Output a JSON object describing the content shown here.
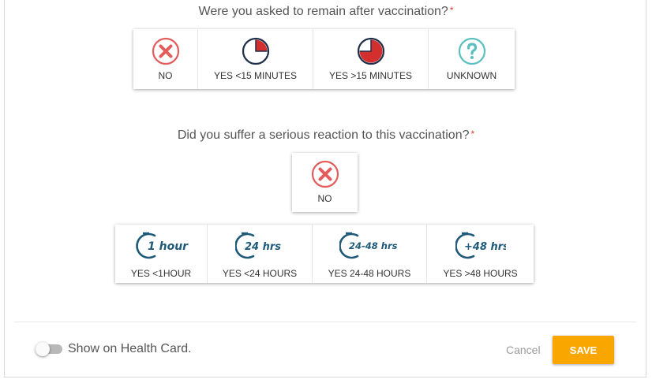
{
  "colors": {
    "accent": "#f9a600",
    "required": "#e53935",
    "no_red": "#e35b5b",
    "unknown_teal": "#5bbfbf",
    "timer_blue": "#1f5a7a",
    "pie_red": "#d32f2f"
  },
  "q1": {
    "question": "Were you asked to remain after vaccination?",
    "required_mark": "*",
    "options": [
      {
        "label": "NO",
        "icon": "x-circle-icon"
      },
      {
        "label": "YES <15 MINUTES",
        "icon": "clock-quarter-icon"
      },
      {
        "label": "YES >15 MINUTES",
        "icon": "clock-three-quarter-icon"
      },
      {
        "label": "UNKNOWN",
        "icon": "question-circle-icon"
      }
    ]
  },
  "q2": {
    "question": "Did you suffer a serious reaction to this vaccination?",
    "required_mark": "*",
    "no_option": {
      "label": "NO",
      "icon": "x-circle-icon"
    },
    "timer_options": [
      {
        "label": "YES <1HOUR",
        "icon_text": "1 hour",
        "icon": "timer-1-hour-icon"
      },
      {
        "label": "YES <24 HOURS",
        "icon_text": "24 hrs",
        "icon": "timer-24-hrs-icon"
      },
      {
        "label": "YES 24-48 HOURS",
        "icon_text": "24-48 hrs",
        "icon": "timer-24-48-hrs-icon"
      },
      {
        "label": "YES >48 HOURS",
        "icon_text": "+48 hrs",
        "icon": "timer-48-hrs-icon"
      }
    ]
  },
  "footer": {
    "toggle_label": "Show on Health Card.",
    "cancel_label": "Cancel",
    "save_label": "SAVE"
  }
}
